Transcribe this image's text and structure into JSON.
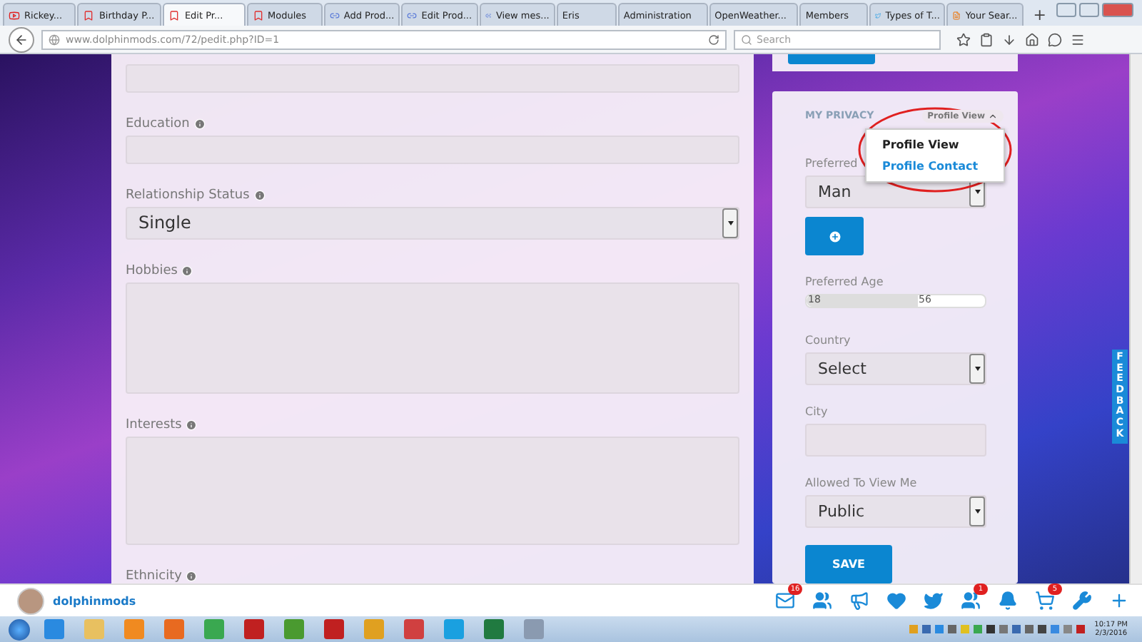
{
  "browser": {
    "tabs": [
      {
        "label": "Rickey...",
        "kind": "video",
        "selected": false
      },
      {
        "label": "Birthday P...",
        "kind": "site",
        "selected": false
      },
      {
        "label": "Edit Pr...",
        "kind": "site",
        "selected": true
      },
      {
        "label": "Modules",
        "kind": "site",
        "selected": false
      },
      {
        "label": "Add Prod...",
        "kind": "link",
        "selected": false
      },
      {
        "label": "Edit Prod...",
        "kind": "link",
        "selected": false
      },
      {
        "label": "View mes...",
        "kind": "link",
        "selected": false
      },
      {
        "label": "Eris",
        "kind": "blank",
        "selected": false
      },
      {
        "label": "Administration",
        "kind": "blank",
        "selected": false
      },
      {
        "label": "OpenWeather...",
        "kind": "blank",
        "selected": false
      },
      {
        "label": "Members",
        "kind": "blank",
        "selected": false
      },
      {
        "label": "Types of T...",
        "kind": "bird",
        "selected": false
      },
      {
        "label": "Your Sear...",
        "kind": "blog",
        "selected": false
      }
    ],
    "new_tab": "+",
    "url_host": "www.dolphinmods.com",
    "url_path": "/72/pedit.php?ID=1",
    "search": {
      "placeholder": "Search"
    }
  },
  "form": {
    "fields": [
      {
        "kind": "input"
      },
      {
        "kind": "input",
        "label": "Education"
      },
      {
        "kind": "select",
        "label": "Relationship Status",
        "value": "Single"
      },
      {
        "kind": "textarea",
        "label": "Hobbies"
      },
      {
        "kind": "textarea",
        "label": "Interests"
      },
      {
        "kind": "label",
        "label": "Ethnicity"
      }
    ]
  },
  "privacy": {
    "title": "MY PRIVACY",
    "dropdown": {
      "label": "Profile View",
      "expanded": true,
      "options": [
        {
          "label": "Profile View",
          "selected": true
        },
        {
          "label": "Profile Contact",
          "selected": false
        }
      ]
    },
    "preferred_label": "Preferred",
    "preferred_value": "Man",
    "age_label": "Preferred Age",
    "age_range": {
      "min": "18",
      "max": "56",
      "level": 0.62
    },
    "country_label": "Country",
    "country_value": "Select",
    "city_label": "City",
    "view_label": "Allowed To View Me",
    "view_value": "Public",
    "save": "SAVE"
  },
  "feedback": "FEEDBACK",
  "site_bar": {
    "user": "dolphinmods",
    "icons": [
      {
        "kind": "mail",
        "badge": "16"
      },
      {
        "kind": "users"
      },
      {
        "kind": "megaphone"
      },
      {
        "kind": "heart"
      },
      {
        "kind": "bird"
      },
      {
        "kind": "users",
        "badge": "1"
      },
      {
        "kind": "bell"
      },
      {
        "kind": "cart",
        "badge": "5"
      },
      {
        "kind": "wrench"
      },
      {
        "kind": "plus"
      }
    ]
  },
  "taskbar": {
    "time": "10:17 PM",
    "date": "2/3/2016"
  }
}
